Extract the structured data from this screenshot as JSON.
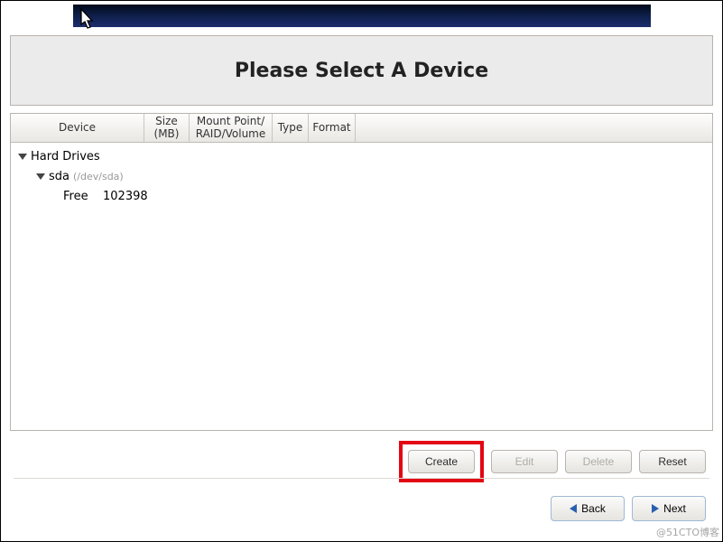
{
  "title": "Please Select A Device",
  "columns": {
    "device": "Device",
    "size": "Size\n(MB)",
    "mount": "Mount Point/\nRAID/Volume",
    "type": "Type",
    "format": "Format"
  },
  "tree": {
    "root_label": "Hard Drives",
    "drive": {
      "name": "sda",
      "path": "(/dev/sda)"
    },
    "free": {
      "label": "Free",
      "size": "102398"
    }
  },
  "buttons": {
    "create": "Create",
    "edit": "Edit",
    "delete": "Delete",
    "reset": "Reset"
  },
  "nav": {
    "back": "Back",
    "next": "Next"
  },
  "watermark": "@51CTO博客"
}
